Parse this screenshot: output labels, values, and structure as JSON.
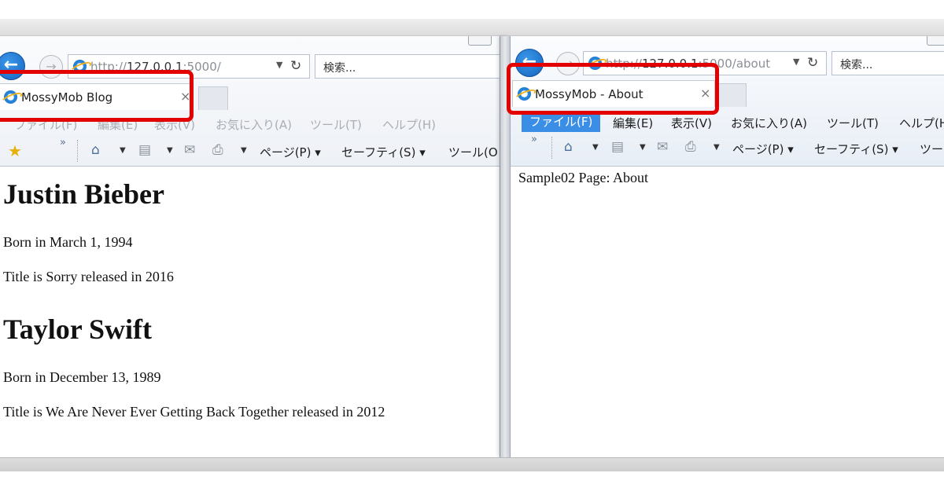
{
  "left_window": {
    "address_url_prefix": "http://",
    "address_url_host": "127.0.0.1",
    "address_url_rest": ":5000/",
    "search_placeholder": "検索...",
    "tab_label": "MossyMob Blog",
    "tab_close": "×",
    "menu": [
      "ファイル(F)",
      "編集(E)",
      "表示(V)",
      "お気に入り(A)",
      "ツール(T)",
      "ヘルプ(H)"
    ],
    "commands": {
      "page": "ページ(P)",
      "safety": "セーフティ(S)",
      "tools": "ツール(O"
    },
    "content": [
      {
        "name": "Justin Bieber",
        "born": "Born in March 1, 1994",
        "title": "Title is Sorry released in 2016"
      },
      {
        "name": "Taylor Swift",
        "born": "Born in December 13, 1989",
        "title": "Title is We Are Never Ever Getting Back Together released in 2012"
      }
    ]
  },
  "right_window": {
    "address_url_prefix": "http://",
    "address_url_host": "127.0.0.1",
    "address_url_rest": ":5000/about",
    "search_placeholder": "検索...",
    "tab_label": "MossyMob - About",
    "tab_close": "×",
    "menu": [
      "ファイル(F)",
      "編集(E)",
      "表示(V)",
      "お気に入り(A)",
      "ツール(T)",
      "ヘルプ(H"
    ],
    "commands": {
      "page": "ページ(P)",
      "safety": "セーフティ(S)",
      "tools": "ツー"
    },
    "content_text": "Sample02 Page: About"
  },
  "icons": {
    "back": "back-arrow-icon",
    "forward": "forward-arrow-icon",
    "refresh": "refresh-icon",
    "home": "home-icon",
    "feed": "feed-icon",
    "mail": "mail-icon",
    "print": "print-icon",
    "favorites": "favorites-star-icon"
  },
  "colors": {
    "highlight": "#e20000",
    "back_button": "#1565c0",
    "active_menu": "#3a8ee6"
  }
}
